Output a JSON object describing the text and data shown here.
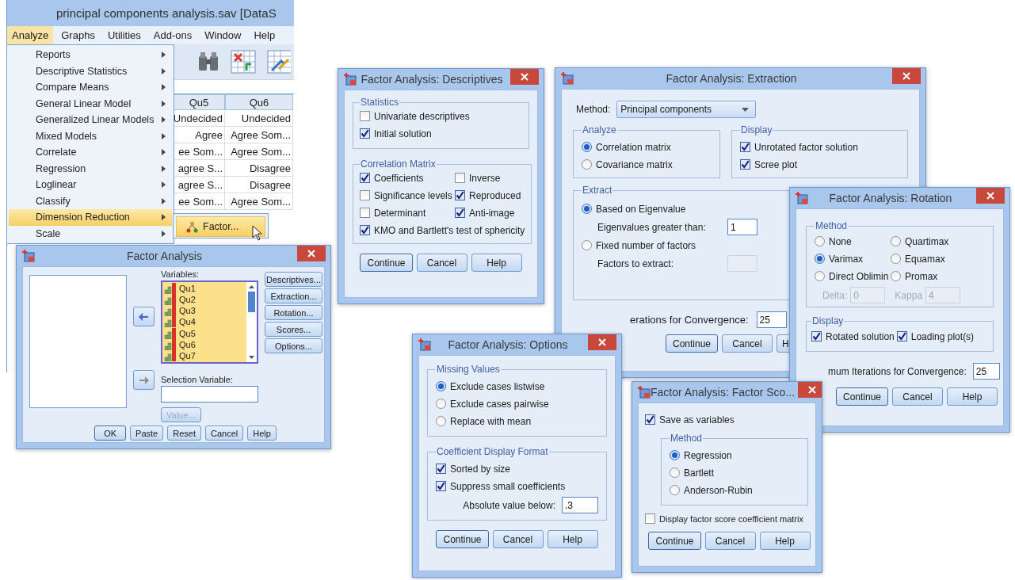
{
  "editor": {
    "title": "principal components analysis.sav [DataS",
    "menu": [
      {
        "label": "Analyze",
        "selected": true
      },
      {
        "label": "Graphs",
        "selected": false
      },
      {
        "label": "Utilities",
        "selected": false
      },
      {
        "label": "Add-ons",
        "selected": false
      },
      {
        "label": "Window",
        "selected": false
      },
      {
        "label": "Help",
        "selected": false
      }
    ],
    "columns": [
      "Qu5",
      "Qu6"
    ],
    "rows": [
      [
        "Undecided",
        "Undecided"
      ],
      [
        "Agree",
        "Agree Som..."
      ],
      [
        "ee Som...",
        "Agree Som..."
      ],
      [
        "agree S...",
        "Disagree"
      ],
      [
        "agree S...",
        "Disagree"
      ],
      [
        "ee Som...",
        "Agree Som..."
      ]
    ]
  },
  "analyze_menu": {
    "items": [
      {
        "label": "Reports",
        "selected": false
      },
      {
        "label": "Descriptive Statistics",
        "selected": false
      },
      {
        "label": "Compare Means",
        "selected": false
      },
      {
        "label": "General Linear Model",
        "selected": false
      },
      {
        "label": "Generalized Linear Models",
        "selected": false
      },
      {
        "label": "Mixed Models",
        "selected": false
      },
      {
        "label": "Correlate",
        "selected": false
      },
      {
        "label": "Regression",
        "selected": false
      },
      {
        "label": "Loglinear",
        "selected": false
      },
      {
        "label": "Classify",
        "selected": false
      },
      {
        "label": "Dimension Reduction",
        "selected": true
      },
      {
        "label": "Scale",
        "selected": false
      }
    ],
    "submenu": [
      {
        "label": "Factor...",
        "selected": true
      }
    ]
  },
  "factor_dialog": {
    "title": "Factor Analysis",
    "variables_label": "Variables:",
    "variables": [
      {
        "name": "Qu1",
        "selected": true
      },
      {
        "name": "Qu2",
        "selected": true
      },
      {
        "name": "Qu3",
        "selected": true
      },
      {
        "name": "Qu4",
        "selected": true
      },
      {
        "name": "Qu5",
        "selected": true
      },
      {
        "name": "Qu6",
        "selected": true
      },
      {
        "name": "Qu7",
        "selected": true
      }
    ],
    "side_buttons": [
      "Descriptives...",
      "Extraction...",
      "Rotation...",
      "Scores...",
      "Options..."
    ],
    "selection_label": "Selection Variable:",
    "value_button": {
      "label": "Value...",
      "disabled": true
    },
    "buttons": [
      "OK",
      "Paste",
      "Reset",
      "Cancel",
      "Help"
    ]
  },
  "descriptives": {
    "title": "Factor Analysis: Descriptives",
    "groups": [
      {
        "title": "Statistics",
        "options": [
          {
            "label": "Univariate descriptives",
            "checked": false
          },
          {
            "label": "Initial solution",
            "checked": true
          }
        ]
      },
      {
        "title": "Correlation Matrix",
        "options": [
          {
            "label": "Coefficients",
            "checked": true
          },
          {
            "label": "Inverse",
            "checked": false
          },
          {
            "label": "Significance levels",
            "checked": false
          },
          {
            "label": "Reproduced",
            "checked": true
          },
          {
            "label": "Determinant",
            "checked": false
          },
          {
            "label": "Anti-image",
            "checked": true
          },
          {
            "label": "KMO and Bartlett's test of sphericity",
            "checked": true
          }
        ]
      }
    ],
    "buttons": [
      "Continue",
      "Cancel",
      "Help"
    ]
  },
  "extraction": {
    "title": "Factor Analysis: Extraction",
    "method_label": "Method:",
    "method": "Principal components",
    "analyze": {
      "title": "Analyze",
      "options": [
        {
          "label": "Correlation matrix",
          "selected": true
        },
        {
          "label": "Covariance matrix",
          "selected": false
        }
      ]
    },
    "display": {
      "title": "Display",
      "options": [
        {
          "label": "Unrotated factor solution",
          "checked": true
        },
        {
          "label": "Scree plot",
          "checked": true
        }
      ]
    },
    "extract": {
      "title": "Extract",
      "options": [
        {
          "label": "Based on Eigenvalue",
          "selected": true,
          "field_label": "Eigenvalues greater than:",
          "value": "1",
          "disabled": false
        },
        {
          "label": "Fixed number of factors",
          "selected": false,
          "field_label": "Factors to extract:",
          "disabled": true
        }
      ]
    },
    "iterations_label": "erations for Convergence:",
    "iterations": "25",
    "buttons": [
      "Continue",
      "Cancel",
      "H"
    ]
  },
  "rotation": {
    "title": "Factor Analysis: Rotation",
    "method": {
      "title": "Method",
      "options": [
        {
          "label": "None",
          "selected": false
        },
        {
          "label": "Quartimax",
          "selected": false
        },
        {
          "label": "Varimax",
          "selected": true
        },
        {
          "label": "Equamax",
          "selected": false
        },
        {
          "label": "Direct Oblimin",
          "selected": false
        },
        {
          "label": "Promax",
          "selected": false
        }
      ],
      "params": [
        {
          "label": "Delta:",
          "value": "0",
          "disabled": true
        },
        {
          "label": "Kappa",
          "value": "4",
          "disabled": true
        }
      ]
    },
    "display": {
      "title": "Display",
      "options": [
        {
          "label": "Rotated solution",
          "checked": true
        },
        {
          "label": "Loading plot(s)",
          "checked": true
        }
      ]
    },
    "iterations_label": "mum Iterations for Convergence:",
    "iterations": "25",
    "buttons": [
      "Continue",
      "Cancel",
      "Help"
    ]
  },
  "options": {
    "title": "Factor Analysis: Options",
    "missing": {
      "title": "Missing Values",
      "options": [
        {
          "label": "Exclude cases listwise",
          "selected": true
        },
        {
          "label": "Exclude cases pairwise",
          "selected": false
        },
        {
          "label": "Replace with mean",
          "selected": false
        }
      ]
    },
    "format": {
      "title": "Coefficient Display Format",
      "options": [
        {
          "label": "Sorted by size",
          "checked": true
        },
        {
          "label": "Suppress small coefficients",
          "checked": true
        }
      ],
      "value_label": "Absolute value below:",
      "value": ".3"
    },
    "buttons": [
      "Continue",
      "Cancel",
      "Help"
    ]
  },
  "scores": {
    "title": "Factor Analysis: Factor Sco...",
    "save": {
      "label": "Save as variables",
      "checked": true
    },
    "method": {
      "title": "Method",
      "options": [
        {
          "label": "Regression",
          "selected": true
        },
        {
          "label": "Bartlett",
          "selected": false
        },
        {
          "label": "Anderson-Rubin",
          "selected": false
        }
      ]
    },
    "display": {
      "label": "Display factor score coefficient matrix",
      "checked": false
    },
    "buttons": [
      "Continue",
      "Cancel",
      "Help"
    ]
  }
}
